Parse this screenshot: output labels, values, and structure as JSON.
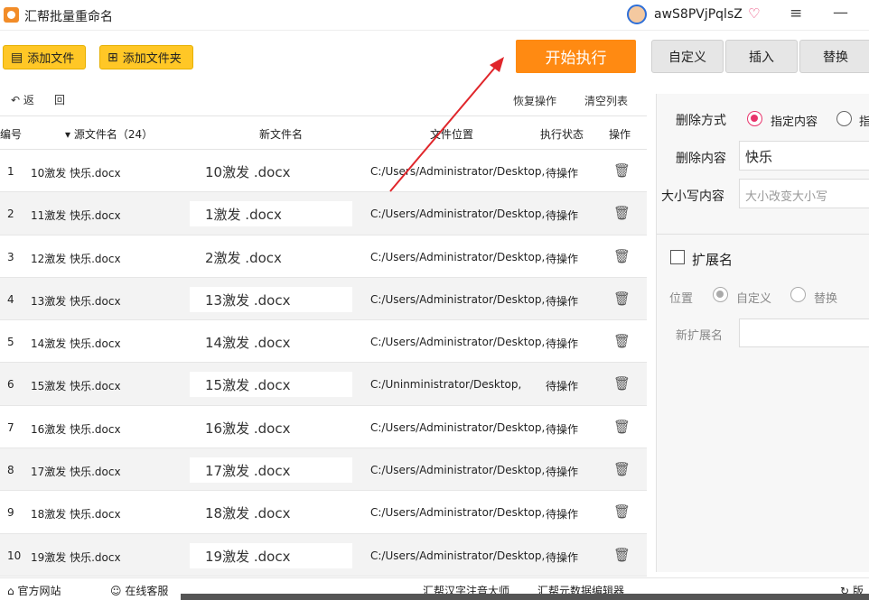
{
  "window": {
    "title": "汇帮批量重命名",
    "user_name": "awS8PVjPqlsZ",
    "menu_glyph": "≡",
    "minimize_glyph": "—",
    "vip_glyph": "♡"
  },
  "toolbar": {
    "add_file_label": "添加文件",
    "add_folder_label": "添加文件夹",
    "start_label": "开始执行",
    "tabs": [
      "自定义",
      "插入",
      "替换"
    ]
  },
  "list_actions": {
    "undo_label": "返",
    "refresh_label": "回",
    "restore_label": "恢复操作",
    "clear_label": "清空列表"
  },
  "table": {
    "headers": {
      "index": "编号",
      "source": "源文件名（24）",
      "new_name": "新文件名",
      "location": "文件位置",
      "status": "执行状态",
      "action": "操作"
    },
    "rows": [
      {
        "index": "1",
        "source": "10激发 快乐.docx",
        "new_name": "10激发 .docx",
        "path": "C:/Users/Administrator/Desktop,",
        "status": "待操作"
      },
      {
        "index": "2",
        "source": "11激发 快乐.docx",
        "new_name": "1激发 .docx",
        "path": "C:/Users/Administrator/Desktop,",
        "status": "待操作"
      },
      {
        "index": "3",
        "source": "12激发 快乐.docx",
        "new_name": "2激发 .docx",
        "path": "C:/Users/Administrator/Desktop,",
        "status": "待操作"
      },
      {
        "index": "4",
        "source": "13激发 快乐.docx",
        "new_name": "13激发 .docx",
        "path": "C:/Users/Administrator/Desktop,",
        "status": "待操作"
      },
      {
        "index": "5",
        "source": "14激发 快乐.docx",
        "new_name": "14激发 .docx",
        "path": "C:/Users/Administrator/Desktop,",
        "status": "待操作"
      },
      {
        "index": "6",
        "source": "15激发 快乐.docx",
        "new_name": "15激发 .docx",
        "path": "C:/Uninministrator/Desktop,",
        "status": "待操作"
      },
      {
        "index": "7",
        "source": "16激发 快乐.docx",
        "new_name": "16激发 .docx",
        "path": "C:/Users/Administrator/Desktop,",
        "status": "待操作"
      },
      {
        "index": "8",
        "source": "17激发 快乐.docx",
        "new_name": "17激发 .docx",
        "path": "C:/Users/Administrator/Desktop,",
        "status": "待操作"
      },
      {
        "index": "9",
        "source": "18激发 快乐.docx",
        "new_name": "18激发 .docx",
        "path": "C:/Users/Administrator/Desktop,",
        "status": "待操作"
      },
      {
        "index": "10",
        "source": "19激发 快乐.docx",
        "new_name": "19激发 .docx",
        "path": "C:/Users/Administrator/Desktop,",
        "status": "待操作"
      }
    ]
  },
  "panel": {
    "delete_mode_label": "删除方式",
    "delete_mode_options": [
      "指定内容",
      "指"
    ],
    "delete_content_label": "删除内容",
    "delete_content_value": "快乐",
    "case_label": "大小写内容",
    "case_placeholder": "大小改变大小写",
    "extension_label": "扩展名",
    "position_label": "位置",
    "position_options": [
      "自定义",
      "替换"
    ],
    "new_ext_label": "新扩展名"
  },
  "footer": {
    "website_label": "官方网站",
    "support_label": "在线客服",
    "link1_label": "汇帮汉字注音大师",
    "link2_label": "汇帮元数据编辑器",
    "version_label": "版"
  },
  "colors": {
    "accent_orange": "#ff8a12",
    "button_yellow": "#ffc726",
    "radio_pink": "#e8336b",
    "arrow_red": "#e0262b"
  }
}
